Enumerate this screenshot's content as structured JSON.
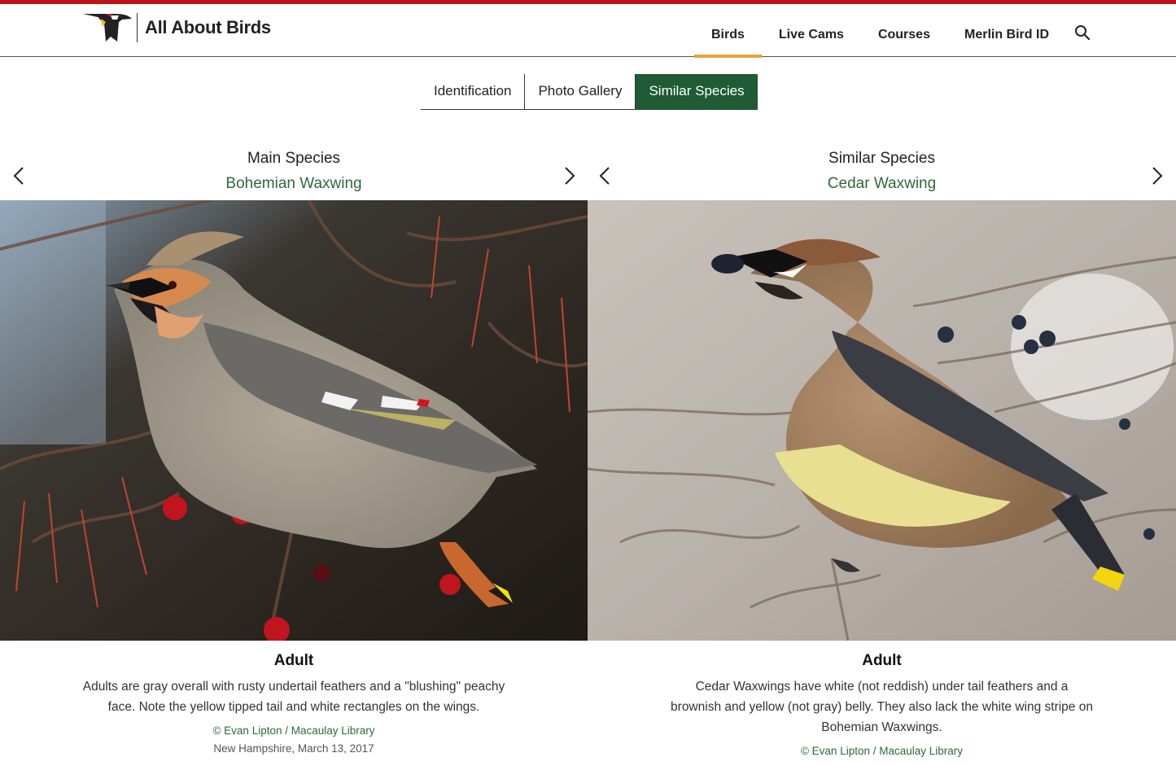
{
  "brand": {
    "name": "All About Birds",
    "accent": "#b8141a",
    "nav_underline": "#e8a33a",
    "green": "#1f5b34"
  },
  "nav": {
    "items": [
      {
        "label": "Birds",
        "active": true
      },
      {
        "label": "Live Cams"
      },
      {
        "label": "Courses"
      },
      {
        "label": "Merlin Bird ID"
      }
    ],
    "search_icon": "search-icon"
  },
  "tabs": [
    {
      "label": "Identification"
    },
    {
      "label": "Photo Gallery"
    },
    {
      "label": "Similar Species",
      "active": true
    }
  ],
  "main": {
    "kicker": "Main Species",
    "species": "Bohemian Waxwing",
    "photo_title": "Adult",
    "description": "Adults are gray overall with rusty undertail feathers and a \"blushing\" peachy face. Note the yellow tipped tail and white rectangles on the wings.",
    "credit": "© Evan Lipton / Macaulay Library",
    "location_date": "New Hampshire, March 13, 2017"
  },
  "similar": {
    "kicker": "Similar Species",
    "species": "Cedar Waxwing",
    "photo_title": "Adult",
    "description": "Cedar Waxwings have white (not reddish) under tail feathers and a brownish and yellow (not gray) belly. They also lack the white wing stripe on Bohemian Waxwings.",
    "credit": "© Evan Lipton / Macaulay Library"
  }
}
